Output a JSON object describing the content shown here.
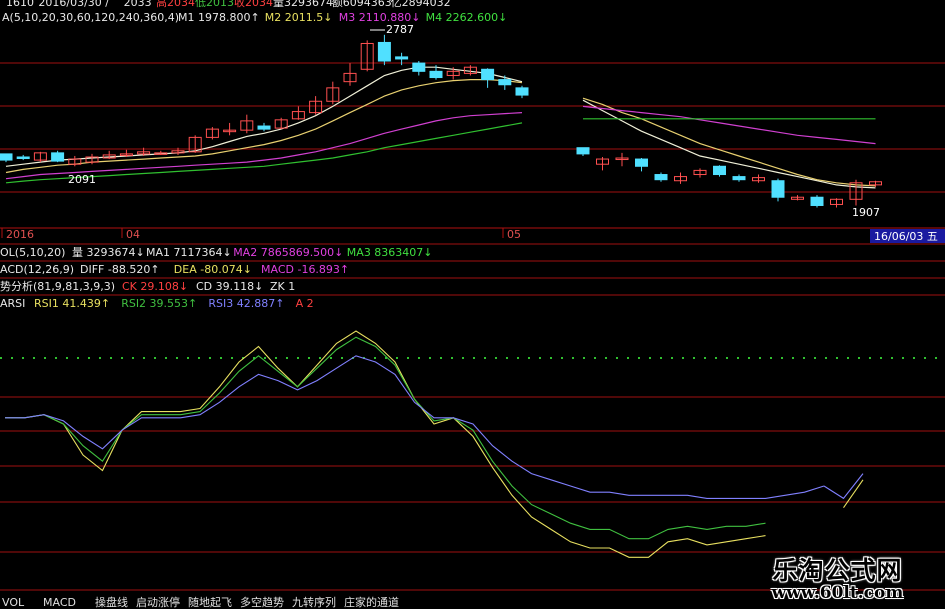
{
  "header": {
    "line1": [
      {
        "text": "1610",
        "color": "#e8e8e8"
      },
      {
        "text": "2016/03/30 /",
        "color": "#e8e8e8"
      },
      {
        "text": "2033",
        "color": "#e8e8e8"
      },
      {
        "text": "高2034",
        "color": "#ff4040"
      },
      {
        "text": "低2013",
        "color": "#40c040"
      },
      {
        "text": "收2034",
        "color": "#ff4040"
      },
      {
        "text": "量3293674",
        "color": "#e8e8e8"
      },
      {
        "text": "额6094363",
        "color": "#e8e8e8"
      },
      {
        "text": "亿2894032",
        "color": "#e8e8e8"
      }
    ],
    "ma_label": "A(5,10,20,30,60,120,240,360,4)",
    "ma_values": [
      {
        "text": "M1 1978.800↑",
        "color": "#e8e8e8"
      },
      {
        "text": "M2 2011.5↓",
        "color": "#e8e060"
      },
      {
        "text": "M3 2110.880↓",
        "color": "#e040e0"
      },
      {
        "text": "M4 2262.600↓",
        "color": "#40e040"
      }
    ]
  },
  "price_chart": {
    "ylim": [
      1880,
      2820
    ],
    "high_label": "2787",
    "low_label_left": "2091",
    "low_label_right": "1907",
    "candles": [
      {
        "o": 2210,
        "h": 2210,
        "c": 2180,
        "l": 2170
      },
      {
        "o": 2195,
        "h": 2205,
        "c": 2190,
        "l": 2180
      },
      {
        "o": 2180,
        "h": 2220,
        "c": 2215,
        "l": 2170
      },
      {
        "o": 2215,
        "h": 2225,
        "c": 2175,
        "l": 2170
      },
      {
        "o": 2160,
        "h": 2200,
        "c": 2185,
        "l": 2150
      },
      {
        "o": 2170,
        "h": 2210,
        "c": 2195,
        "l": 2160
      },
      {
        "o": 2190,
        "h": 2225,
        "c": 2205,
        "l": 2185
      },
      {
        "o": 2205,
        "h": 2230,
        "c": 2210,
        "l": 2195
      },
      {
        "o": 2210,
        "h": 2240,
        "c": 2220,
        "l": 2200
      },
      {
        "o": 2210,
        "h": 2225,
        "c": 2215,
        "l": 2205
      },
      {
        "o": 2215,
        "h": 2240,
        "c": 2225,
        "l": 2205
      },
      {
        "o": 2220,
        "h": 2300,
        "c": 2290,
        "l": 2215
      },
      {
        "o": 2290,
        "h": 2340,
        "c": 2330,
        "l": 2280
      },
      {
        "o": 2320,
        "h": 2360,
        "c": 2325,
        "l": 2300
      },
      {
        "o": 2325,
        "h": 2400,
        "c": 2370,
        "l": 2310
      },
      {
        "o": 2345,
        "h": 2360,
        "c": 2330,
        "l": 2320
      },
      {
        "o": 2335,
        "h": 2385,
        "c": 2375,
        "l": 2330
      },
      {
        "o": 2380,
        "h": 2440,
        "c": 2415,
        "l": 2375
      },
      {
        "o": 2410,
        "h": 2490,
        "c": 2465,
        "l": 2400
      },
      {
        "o": 2465,
        "h": 2560,
        "c": 2530,
        "l": 2450
      },
      {
        "o": 2560,
        "h": 2650,
        "c": 2600,
        "l": 2540
      },
      {
        "o": 2620,
        "h": 2760,
        "c": 2745,
        "l": 2610
      },
      {
        "o": 2750,
        "h": 2787,
        "c": 2660,
        "l": 2640
      },
      {
        "o": 2680,
        "h": 2700,
        "c": 2670,
        "l": 2640
      },
      {
        "o": 2650,
        "h": 2660,
        "c": 2610,
        "l": 2590
      },
      {
        "o": 2610,
        "h": 2640,
        "c": 2580,
        "l": 2570
      },
      {
        "o": 2590,
        "h": 2630,
        "c": 2610,
        "l": 2570
      },
      {
        "o": 2600,
        "h": 2640,
        "c": 2630,
        "l": 2590
      },
      {
        "o": 2620,
        "h": 2625,
        "c": 2570,
        "l": 2530
      },
      {
        "o": 2570,
        "h": 2590,
        "c": 2545,
        "l": 2520
      },
      {
        "o": 2530,
        "h": 2540,
        "c": 2495,
        "l": 2480
      },
      {
        "o": 2240,
        "h": 2240,
        "c": 2210,
        "l": 2200
      },
      {
        "o": 2160,
        "h": 2195,
        "c": 2185,
        "l": 2130
      },
      {
        "o": 2190,
        "h": 2215,
        "c": 2190,
        "l": 2150
      },
      {
        "o": 2185,
        "h": 2190,
        "c": 2150,
        "l": 2125
      },
      {
        "o": 2110,
        "h": 2120,
        "c": 2085,
        "l": 2075
      },
      {
        "o": 2080,
        "h": 2120,
        "c": 2100,
        "l": 2065
      },
      {
        "o": 2110,
        "h": 2140,
        "c": 2130,
        "l": 2095
      },
      {
        "o": 2150,
        "h": 2155,
        "c": 2110,
        "l": 2100
      },
      {
        "o": 2100,
        "h": 2110,
        "c": 2085,
        "l": 2075
      },
      {
        "o": 2080,
        "h": 2110,
        "c": 2095,
        "l": 2070
      },
      {
        "o": 2080,
        "h": 2090,
        "c": 2000,
        "l": 1980
      },
      {
        "o": 1990,
        "h": 2010,
        "c": 2000,
        "l": 1985
      },
      {
        "o": 2000,
        "h": 2010,
        "c": 1960,
        "l": 1950
      },
      {
        "o": 1965,
        "h": 1995,
        "c": 1990,
        "l": 1950
      },
      {
        "o": 1990,
        "h": 2085,
        "c": 2070,
        "l": 1960
      },
      {
        "o": 2060,
        "h": 2080,
        "c": 2075,
        "l": 2050
      }
    ],
    "ma_series": [
      {
        "color": "#f0f0d8",
        "values": [
          2150,
          2160,
          2170,
          2180,
          2185,
          2190,
          2195,
          2200,
          2205,
          2210,
          2215,
          2225,
          2245,
          2270,
          2295,
          2310,
          2330,
          2360,
          2395,
          2440,
          2490,
          2540,
          2590,
          2615,
          2630,
          2630,
          2620,
          2610,
          2600,
          2580,
          2560,
          2470,
          2420,
          2370,
          2320,
          2280,
          2240,
          2200,
          2180,
          2160,
          2140,
          2120,
          2100,
          2080,
          2060,
          2050,
          2045
        ]
      },
      {
        "color": "#e8d070",
        "values": [
          2120,
          2135,
          2145,
          2155,
          2160,
          2170,
          2175,
          2180,
          2185,
          2190,
          2195,
          2200,
          2210,
          2225,
          2240,
          2255,
          2275,
          2300,
          2330,
          2370,
          2410,
          2450,
          2490,
          2520,
          2540,
          2555,
          2565,
          2570,
          2570,
          2565,
          2555,
          2480,
          2450,
          2410,
          2380,
          2340,
          2300,
          2260,
          2230,
          2200,
          2170,
          2140,
          2110,
          2085,
          2070,
          2060,
          2055
        ]
      },
      {
        "color": "#d040d0",
        "values": [
          2090,
          2100,
          2110,
          2115,
          2120,
          2125,
          2130,
          2135,
          2140,
          2145,
          2150,
          2155,
          2160,
          2165,
          2170,
          2180,
          2190,
          2205,
          2220,
          2240,
          2260,
          2285,
          2310,
          2330,
          2350,
          2370,
          2385,
          2395,
          2400,
          2405,
          2410,
          2440,
          2430,
          2420,
          2410,
          2400,
          2390,
          2375,
          2360,
          2345,
          2330,
          2315,
          2300,
          2290,
          2280,
          2270,
          2260
        ]
      },
      {
        "color": "#30c030",
        "values": [
          2070,
          2078,
          2085,
          2090,
          2095,
          2100,
          2105,
          2110,
          2115,
          2120,
          2125,
          2130,
          2135,
          2140,
          2145,
          2150,
          2160,
          2170,
          2180,
          2190,
          2205,
          2220,
          2240,
          2255,
          2270,
          2285,
          2300,
          2315,
          2330,
          2345,
          2360,
          2380,
          2380,
          2380,
          2380,
          2380,
          2380,
          2380,
          2380,
          2380,
          2380,
          2380,
          2380,
          2380,
          2380,
          2380,
          2380
        ]
      }
    ]
  },
  "date_axis": {
    "labels": [
      "2016",
      "04",
      "05"
    ],
    "cursor_label": "16/06/03 五"
  },
  "indicators": {
    "vol_label": "OL(5,10,20)",
    "vol_values": [
      {
        "text": "量 3293674↓",
        "color": "#e8e8e8"
      },
      {
        "text": "MA1 7117364↓",
        "color": "#e8e8e8"
      },
      {
        "text": "MA2 7865869.500↓",
        "color": "#e040e0"
      },
      {
        "text": "MA3 8363407↓",
        "color": "#40e040"
      }
    ],
    "macd_label": "ACD(12,26,9)",
    "macd_values": [
      {
        "text": "DIFF -88.520↑",
        "color": "#e8e8e8"
      },
      {
        "text": "DEA -80.074↓",
        "color": "#e8e060"
      },
      {
        "text": "MACD -16.893↑",
        "color": "#e040e0"
      }
    ],
    "trend_label": "势分析(81,9,81,3,9,3)",
    "trend_values": [
      {
        "text": "CK 29.108↓",
        "color": "#ff4040"
      },
      {
        "text": "CD 39.118↓",
        "color": "#e8e8e8"
      },
      {
        "text": "ZK 1",
        "color": "#e8e8e8"
      }
    ],
    "rsi_label": "ARSI",
    "rsi_values": [
      {
        "text": "RSI1 41.439↑",
        "color": "#e8e060"
      },
      {
        "text": "RSI2 39.553↑",
        "color": "#40c040"
      },
      {
        "text": "RSI3 42.887↑",
        "color": "#8080ff"
      },
      {
        "text": "A 2",
        "color": "#ff4040"
      }
    ]
  },
  "chart_data": {
    "type": "line",
    "title": "",
    "xlabel": "",
    "ylabel": "",
    "x": [
      0,
      1,
      2,
      3,
      4,
      5,
      6,
      7,
      8,
      9,
      10,
      11,
      12,
      13,
      14,
      15,
      16,
      17,
      18,
      19,
      20,
      21,
      22,
      23,
      24,
      25,
      26,
      27,
      28,
      29,
      30,
      31,
      32,
      33,
      34,
      35,
      36,
      37,
      38,
      39,
      40,
      41,
      42,
      43,
      44,
      45,
      46,
      47
    ],
    "ylim": [
      0,
      100
    ],
    "grid": true,
    "series": [
      {
        "name": "RSI1",
        "color": "#e8e060",
        "values": [
          62,
          62,
          63,
          60,
          50,
          45,
          58,
          64,
          64,
          64,
          65,
          72,
          80,
          85,
          78,
          72,
          79,
          86,
          90,
          86,
          80,
          68,
          60,
          62,
          56,
          46,
          37,
          30,
          26,
          22,
          20,
          20,
          17,
          17,
          22,
          23,
          21,
          22,
          23,
          24,
          null,
          null,
          null,
          null,
          null,
          null,
          null,
          null
        ]
      },
      {
        "name": "RSI2",
        "color": "#40c040",
        "values": [
          62,
          62,
          63,
          60,
          53,
          48,
          58,
          63,
          63,
          63,
          64,
          70,
          77,
          82,
          77,
          72,
          78,
          84,
          88,
          85,
          79,
          68,
          61,
          62,
          58,
          48,
          40,
          34,
          31,
          28,
          26,
          26,
          23,
          23,
          26,
          27,
          26,
          27,
          27,
          28,
          null,
          null,
          null,
          null,
          null,
          null,
          null,
          null
        ]
      },
      {
        "name": "RSI3",
        "color": "#8080ff",
        "values": [
          62,
          62,
          63,
          61,
          56,
          52,
          58,
          62,
          62,
          62,
          63,
          67,
          72,
          76,
          74,
          71,
          74,
          78,
          82,
          80,
          76,
          67,
          62,
          62,
          60,
          53,
          48,
          44,
          42,
          40,
          38,
          38,
          37,
          37,
          37,
          37,
          36,
          36,
          36,
          36,
          37,
          38,
          40,
          null,
          null,
          null,
          null,
          null
        ]
      }
    ],
    "tail": {
      "RSI1_end": [
        33,
        42
      ],
      "RSI3_end": [
        36,
        44
      ]
    }
  },
  "tabs": [
    "VOL",
    "MACD",
    "操盘线",
    "启动涨停",
    "随地起飞",
    "多空趋势",
    "九转序列",
    "庄家的通道"
  ],
  "watermark": {
    "title": "乐淘公式网",
    "url": "www.60lt.com"
  }
}
